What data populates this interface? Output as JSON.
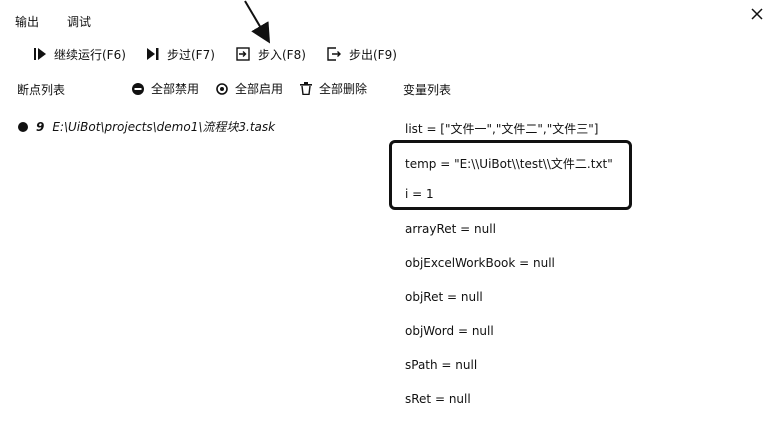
{
  "tabs": [
    {
      "label": "输出"
    },
    {
      "label": "调试"
    }
  ],
  "toolbar": {
    "continue": "继续运行(F6)",
    "step_over": "步过(F7)",
    "step_into": "步入(F8)",
    "step_out": "步出(F9)"
  },
  "breakpoints": {
    "header": "断点列表",
    "disable_all": "全部禁用",
    "enable_all": "全部启用",
    "delete_all": "全部删除",
    "items": [
      {
        "line": "9",
        "path": "E:\\UiBot\\projects\\demo1\\流程块3.task"
      }
    ]
  },
  "variables": {
    "header": "变量列表",
    "items": [
      {
        "text": "list = [\"文件一\",\"文件二\",\"文件三\"]"
      },
      {
        "text": "temp = \"E:\\\\UiBot\\\\test\\\\文件二.txt\""
      },
      {
        "text": "i = 1"
      },
      {
        "text": "arrayRet = null"
      },
      {
        "text": "objExcelWorkBook = null"
      },
      {
        "text": "objRet = null"
      },
      {
        "text": "objWord = null"
      },
      {
        "text": "sPath = null"
      },
      {
        "text": "sRet = null"
      }
    ]
  },
  "icons": {
    "close": "close-icon",
    "continue": "play-icon",
    "step_over": "step-over-icon",
    "step_into": "step-into-icon",
    "step_out": "step-out-icon",
    "disable_all": "minus-circle-icon",
    "enable_all": "gear-icon",
    "delete_all": "trash-icon",
    "breakpoint": "breakpoint-dot-icon"
  }
}
